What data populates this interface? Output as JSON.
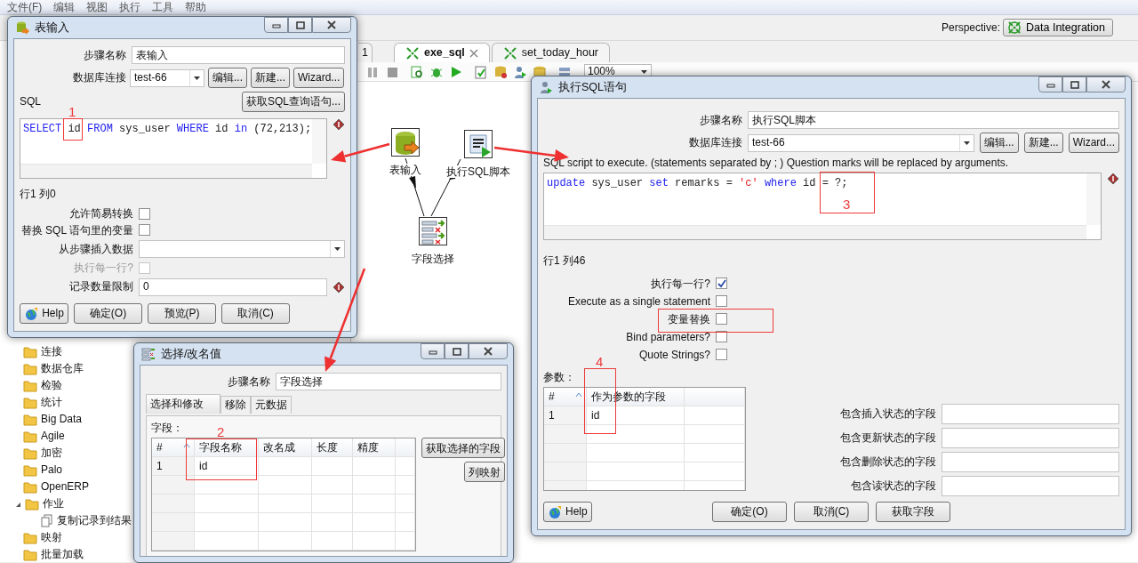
{
  "menu": [
    {
      "label": "文件(F)"
    },
    {
      "label": "编辑"
    },
    {
      "label": "视图"
    },
    {
      "label": "执行"
    },
    {
      "label": "工具"
    },
    {
      "label": "帮助"
    }
  ],
  "perspective": {
    "label": "Perspective:",
    "button": "Data Integration"
  },
  "editor_tabs": [
    {
      "label": "1",
      "selected": false,
      "closable": false
    },
    {
      "label": "exe_sql",
      "selected": true,
      "closable": true
    },
    {
      "label": "set_today_hour",
      "selected": false,
      "closable": false
    }
  ],
  "toolbar": {
    "zoom": "100%"
  },
  "canvas": {
    "steps": [
      {
        "label": "表输入",
        "kind": "table"
      },
      {
        "label": "执行SQL脚本",
        "kind": "sql"
      },
      {
        "label": "字段选择",
        "kind": "select"
      }
    ]
  },
  "tree": [
    {
      "label": "连接"
    },
    {
      "label": "数据仓库"
    },
    {
      "label": "检验"
    },
    {
      "label": "统计"
    },
    {
      "label": "Big Data"
    },
    {
      "label": "Agile"
    },
    {
      "label": "加密"
    },
    {
      "label": "Palo"
    },
    {
      "label": "OpenERP"
    },
    {
      "label": "作业",
      "expanded": true,
      "children": [
        {
          "label": "复制记录到结果"
        }
      ]
    },
    {
      "label": "映射"
    },
    {
      "label": "批量加载"
    }
  ],
  "table_input_dialog": {
    "title": "表输入",
    "step_name_label": "步骤名称",
    "step_name": "表输入",
    "connection_label": "数据库连接",
    "connection": "test-66",
    "connection_buttons": [
      "编辑...",
      "新建...",
      "Wizard..."
    ],
    "sql_label": "SQL",
    "get_sql_button": "获取SQL查询语句...",
    "sql": [
      {
        "text": "SELECT",
        "kind": "keyword"
      },
      {
        "text": " id ",
        "kind": "plain"
      },
      {
        "text": "FROM",
        "kind": "keyword"
      },
      {
        "text": " sys_user ",
        "kind": "plain"
      },
      {
        "text": "WHERE",
        "kind": "keyword"
      },
      {
        "text": " id ",
        "kind": "plain"
      },
      {
        "text": "in",
        "kind": "keyword"
      },
      {
        "text": " (72,213);",
        "kind": "plain"
      }
    ],
    "cursor": "行1 列0",
    "options": [
      {
        "label": "允许简易转换",
        "kind": "checkbox",
        "checked": false,
        "disabled": false
      },
      {
        "label": "替换 SQL 语句里的变量",
        "kind": "checkbox",
        "checked": false,
        "disabled": false
      },
      {
        "label": "从步骤插入数据",
        "kind": "dropdown"
      },
      {
        "label": "执行每一行?",
        "kind": "checkbox",
        "checked": false,
        "disabled": true
      },
      {
        "label": "记录数量限制",
        "kind": "field",
        "value": "0"
      }
    ],
    "buttons": [
      {
        "label": "Help",
        "kind": "help"
      },
      {
        "label": "确定(O)",
        "kind": "plain"
      },
      {
        "label": "预览(P)",
        "kind": "plain"
      },
      {
        "label": "取消(C)",
        "kind": "plain"
      }
    ]
  },
  "select_dialog": {
    "title": "选择/改名值",
    "step_name_label": "步骤名称",
    "step_name": "字段选择",
    "tabs": [
      {
        "label": "选择和修改",
        "selected": true
      },
      {
        "label": "移除",
        "selected": false
      },
      {
        "label": "元数据",
        "selected": false
      }
    ],
    "fields_label": "字段：",
    "columns": [
      "#",
      "字段名称",
      "改名成",
      "长度",
      "精度"
    ],
    "rows": [
      [
        "1",
        "id"
      ]
    ],
    "buttons": [
      "获取选择的字段",
      "列映射"
    ]
  },
  "sql_dialog": {
    "title": "执行SQL语句",
    "step_name_label": "步骤名称",
    "step_name": "执行SQL脚本",
    "connection_label": "数据库连接",
    "connection": "test-66",
    "connection_buttons": [
      "编辑...",
      "新建...",
      "Wizard..."
    ],
    "description": "SQL script to execute. (statements separated by ; ) Question marks will be replaced by arguments.",
    "sql": [
      {
        "text": "update",
        "kind": "keyword"
      },
      {
        "text": " sys_user ",
        "kind": "plain"
      },
      {
        "text": "set",
        "kind": "keyword"
      },
      {
        "text": " remarks = ",
        "kind": "plain"
      },
      {
        "text": "'c' ",
        "kind": "string"
      },
      {
        "text": "where",
        "kind": "keyword"
      },
      {
        "text": " id = ?;",
        "kind": "plain"
      }
    ],
    "cursor": "行1 列46",
    "options": [
      {
        "label": "执行每一行?",
        "checked": true
      },
      {
        "label": "Execute as a single statement",
        "checked": false
      },
      {
        "label": "变量替换",
        "checked": false
      },
      {
        "label": "Bind parameters?",
        "checked": false
      },
      {
        "label": "Quote Strings?",
        "checked": false
      }
    ],
    "params_label": "参数：",
    "param_columns": [
      "#",
      "作为参数的字段"
    ],
    "param_rows": [
      [
        "1",
        "id"
      ]
    ],
    "status_fields": [
      {
        "label": "包含插入状态的字段"
      },
      {
        "label": "包含更新状态的字段"
      },
      {
        "label": "包含删除状态的字段"
      },
      {
        "label": "包含读状态的字段"
      }
    ],
    "buttons": [
      {
        "label": "Help",
        "kind": "help"
      },
      {
        "label": "确定(O)",
        "kind": "plain"
      },
      {
        "label": "取消(C)",
        "kind": "plain"
      },
      {
        "label": "获取字段",
        "kind": "plain"
      }
    ]
  },
  "annotations": [
    {
      "kind": "numbered",
      "label": "1"
    },
    {
      "kind": "numbered",
      "label": "2"
    },
    {
      "kind": "numbered",
      "label": "3"
    },
    {
      "kind": "numbered",
      "label": "4"
    },
    {
      "kind": "box"
    }
  ]
}
